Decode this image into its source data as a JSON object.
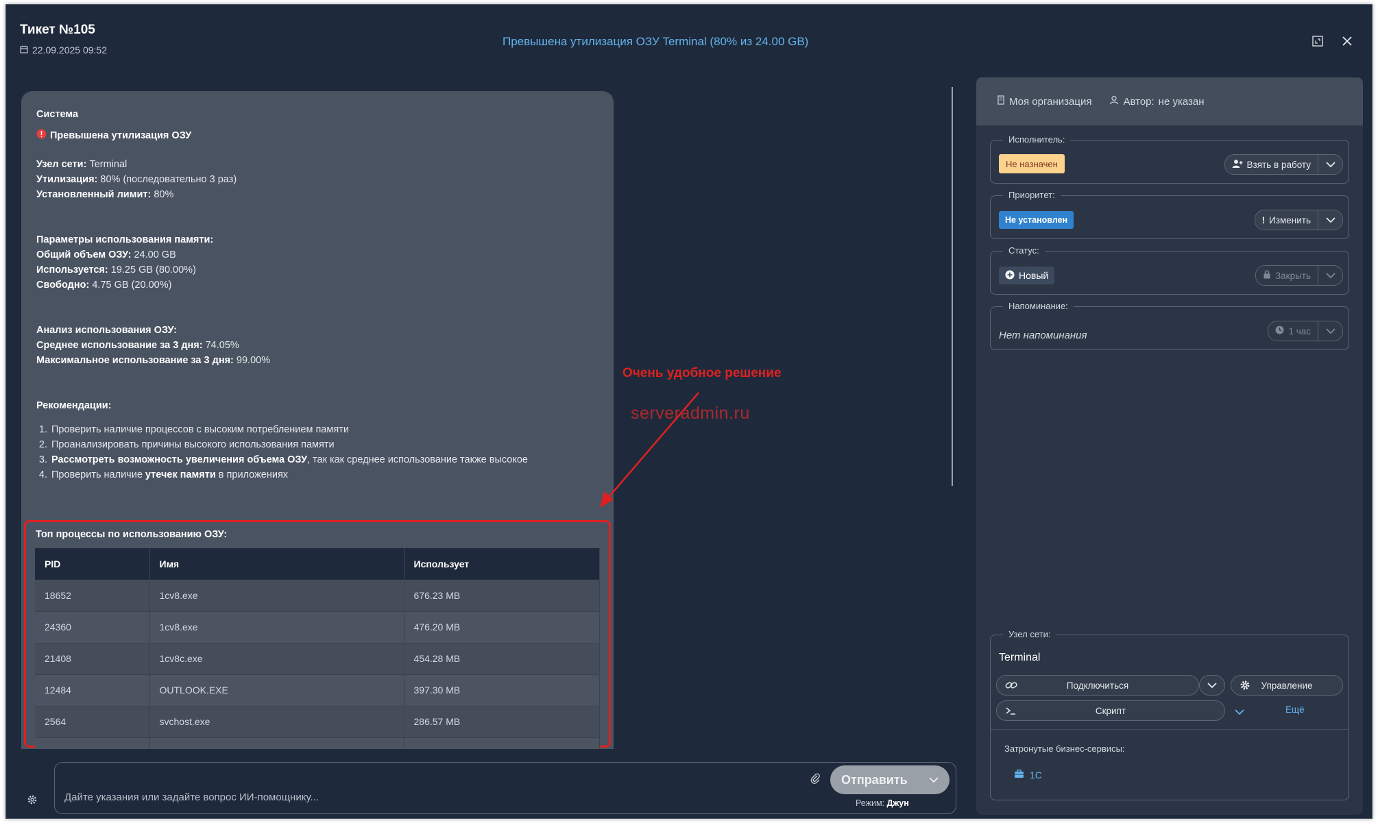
{
  "header": {
    "ticket_title": "Тикет №105",
    "date": "22.09.2025 09:52",
    "subject": "Превышена утилизация ОЗУ Terminal (80% из 24.00 GB)"
  },
  "message": {
    "sender": "Система",
    "alert": "Превышена утилизация ОЗУ",
    "node_label": "Узел сети:",
    "node_value": "Terminal",
    "util_label": "Утилизация:",
    "util_value": "80% (последовательно 3 раз)",
    "limit_label": "Установленный лимит:",
    "limit_value": "80%",
    "mem_params_title": "Параметры использования памяти:",
    "total_label": "Общий объем ОЗУ:",
    "total_value": "24.00 GB",
    "used_label": "Используется:",
    "used_value": "19.25 GB (80.00%)",
    "free_label": "Свободно:",
    "free_value": "4.75 GB (20.00%)",
    "analysis_title": "Анализ использования ОЗУ:",
    "avg_label": "Среднее использование за 3 дня:",
    "avg_value": "74.05%",
    "max_label": "Максимальное использование за 3 дня:",
    "max_value": "99.00%",
    "reco_title": "Рекомендации:",
    "reco_1": "Проверить наличие процессов с высоким потреблением памяти",
    "reco_2": "Проанализировать причины высокого использования памяти",
    "reco_3_bold": "Рассмотреть возможность увеличения объема ОЗУ",
    "reco_3_rest": ", так как среднее использование также высокое",
    "reco_4_pre": "Проверить наличие ",
    "reco_4_bold": "утечек памяти",
    "reco_4_post": " в приложениях",
    "top_title": "Топ процессы по использованию ОЗУ:",
    "table": {
      "headers": [
        "PID",
        "Имя",
        "Использует"
      ],
      "rows": [
        [
          "18652",
          "1cv8.exe",
          "676.23 MB"
        ],
        [
          "24360",
          "1cv8.exe",
          "476.20 MB"
        ],
        [
          "21408",
          "1cv8c.exe",
          "454.28 MB"
        ],
        [
          "12484",
          "OUTLOOK.EXE",
          "397.30 MB"
        ],
        [
          "2564",
          "svchost.exe",
          "286.57 MB"
        ]
      ]
    }
  },
  "annotations": {
    "callout": "Очень удобное решение",
    "watermark": "serveradmin.ru"
  },
  "side": {
    "org": "Моя организация",
    "author_label": "Автор:",
    "author_value": "не указан",
    "assignee_label": "Исполнитель:",
    "assignee_value": "Не назначен",
    "take_button": "Взять в работу",
    "priority_label": "Приоритет:",
    "priority_value": "Не установлен",
    "change_button": "Изменить",
    "status_label": "Статус:",
    "status_value": "Новый",
    "close_button": "Закрыть",
    "reminder_label": "Напоминание:",
    "reminder_value": "Нет напоминания",
    "reminder_button": "1 час",
    "node_label": "Узел сети:",
    "node_value": "Terminal",
    "connect_button": "Подключиться",
    "manage_button": "Управление",
    "script_button": "Скрипт",
    "more_link": "Ещё",
    "biz_title": "Затронутые бизнес-сервисы:",
    "biz_item": "1С"
  },
  "composer": {
    "placeholder": "Дайте указания или задайте вопрос ИИ-помощнику...",
    "send_button": "Отправить",
    "mode_label": "Режим:",
    "mode_value": "Джун"
  },
  "colors": {
    "background": "#1e2a3b",
    "bubble": "#4a5361",
    "accent_blue": "#63b3ed",
    "annotation_red": "#e02020",
    "badge_orange": "#fbd38d",
    "badge_blue": "#3182ce"
  }
}
